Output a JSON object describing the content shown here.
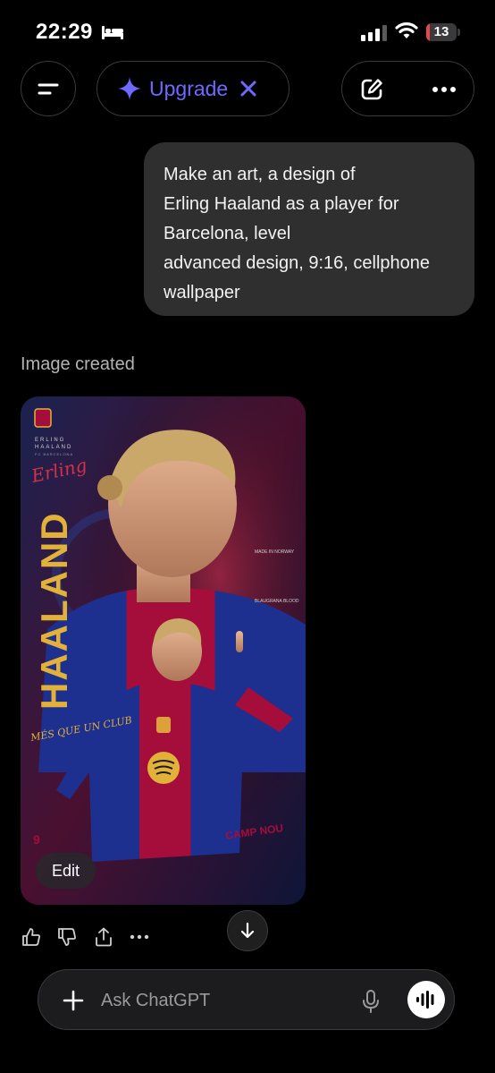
{
  "status_bar": {
    "time": "22:29",
    "battery_level": "13",
    "battery_fraction": 0.13
  },
  "header": {
    "upgrade_label": "Upgrade"
  },
  "conversation": {
    "user_message": [
      "Make an art, a design of",
      "Erling Haaland as a player for",
      "Barcelona, level",
      "advanced design, 9:16, cellphone",
      "wallpaper"
    ],
    "image_created_label": "Image created",
    "image_text": {
      "top_name": "ERLING",
      "top_surname": "HAALAND",
      "top_caption": "FC BARCELONA",
      "script_name": "Erling",
      "vertical_name": "HAALAND",
      "made_in": "MADE IN NORWAY",
      "blaugrana": "BLAUGRANA BLOOD",
      "mes": "MÉS QUE UN CLUB",
      "number": "9",
      "camp_nou": "CAMP NOU",
      "crest": "FCB"
    },
    "edit_label": "Edit"
  },
  "composer": {
    "placeholder": "Ask ChatGPT"
  },
  "colors": {
    "accent": "#6e6aff",
    "bubble": "#2f2f2f",
    "battery": "#e5484d",
    "blaugrana_blue": "#1d2f8f",
    "blaugrana_red": "#a50d3b",
    "gold": "#e2b13a"
  }
}
